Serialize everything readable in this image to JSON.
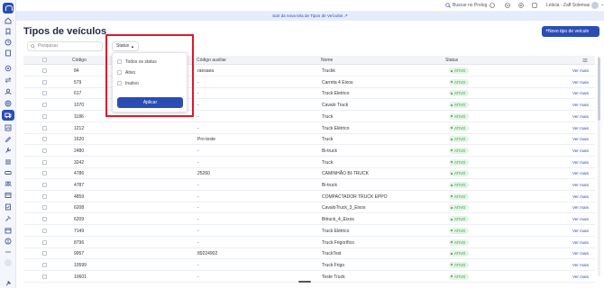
{
  "topbar": {
    "search_label": "Buscar no Prolog",
    "user_name": "Leticia - Zaff Solemas"
  },
  "banner": {
    "text": "Sair da nova tela de Tipos de Veículos"
  },
  "page": {
    "title": "Tipos de veículos",
    "new_button": "Novo tipo de veículo",
    "search_placeholder": "Pesquisar",
    "status_filter_label": "Status"
  },
  "dropdown": {
    "options": [
      {
        "label": "Todos os status",
        "checked": false
      },
      {
        "label": "Ativo",
        "checked": false
      },
      {
        "label": "Inativo",
        "checked": false
      }
    ],
    "apply_label": "Aplicar"
  },
  "table": {
    "columns": [
      "Código",
      "Código auxiliar",
      "Nome",
      "Status"
    ],
    "rows": [
      {
        "codigo": "84",
        "auxiliar": "raesaea",
        "nome": "Truckk",
        "status": "ATIVO",
        "action": "Ver mais"
      },
      {
        "codigo": "579",
        "auxiliar": "-",
        "nome": "Carreta 4 Eixos",
        "status": "ATIVO",
        "action": "Ver mais"
      },
      {
        "codigo": "617",
        "auxiliar": "-",
        "nome": "Truck Eletrico",
        "status": "ATIVO",
        "action": "Ver mais"
      },
      {
        "codigo": "1070",
        "auxiliar": "-",
        "nome": "Cavalo Truck",
        "status": "ATIVO",
        "action": "Ver mais"
      },
      {
        "codigo": "1186",
        "auxiliar": "-",
        "nome": "Truck",
        "status": "ATIVO",
        "action": "Ver mais"
      },
      {
        "codigo": "1212",
        "auxiliar": "-",
        "nome": "Truck Elétrico",
        "status": "ATIVO",
        "action": "Ver mais"
      },
      {
        "codigo": "1620",
        "auxiliar": "Pro teste",
        "nome": "Truck",
        "status": "ATIVO",
        "action": "Ver mais"
      },
      {
        "codigo": "2480",
        "auxiliar": "-",
        "nome": "Bi-truck",
        "status": "ATIVO",
        "action": "Ver mais"
      },
      {
        "codigo": "3242",
        "auxiliar": "-",
        "nome": "Truck",
        "status": "ATIVO",
        "action": "Ver mais"
      },
      {
        "codigo": "4786",
        "auxiliar": "25260",
        "nome": "CAMINHÃO BI-TRUCK",
        "status": "ATIVO",
        "action": "Ver mais"
      },
      {
        "codigo": "4787",
        "auxiliar": "-",
        "nome": "Bi-truck",
        "status": "ATIVO",
        "action": "Ver mais"
      },
      {
        "codigo": "4859",
        "auxiliar": "-",
        "nome": "COMPACTADOR TRUCK EPPO",
        "status": "ATIVO",
        "action": "Ver mais"
      },
      {
        "codigo": "6208",
        "auxiliar": "-",
        "nome": "CavaloTruck_3_Eixos",
        "status": "ATIVO",
        "action": "Ver mais"
      },
      {
        "codigo": "6209",
        "auxiliar": "-",
        "nome": "Bitruck_4_Eixos",
        "status": "ATIVO",
        "action": "Ver mais"
      },
      {
        "codigo": "7149",
        "auxiliar": "-",
        "nome": "Truck Elétrico",
        "status": "ATIVO",
        "action": "Ver mais"
      },
      {
        "codigo": "8796",
        "auxiliar": "-",
        "nome": "Truck Frigorífico",
        "status": "ATIVO",
        "action": "Ver mais"
      },
      {
        "codigo": "9957",
        "auxiliar": "89224902",
        "nome": "TruckTest",
        "status": "ATIVO",
        "action": "Ver mais"
      },
      {
        "codigo": "10599",
        "auxiliar": "-",
        "nome": "Truck Frigo",
        "status": "ATIVO",
        "action": "Ver mais"
      },
      {
        "codigo": "10601",
        "auxiliar": "-",
        "nome": "Teste Truck",
        "status": "ATIVO",
        "action": "Ver mais"
      }
    ]
  }
}
